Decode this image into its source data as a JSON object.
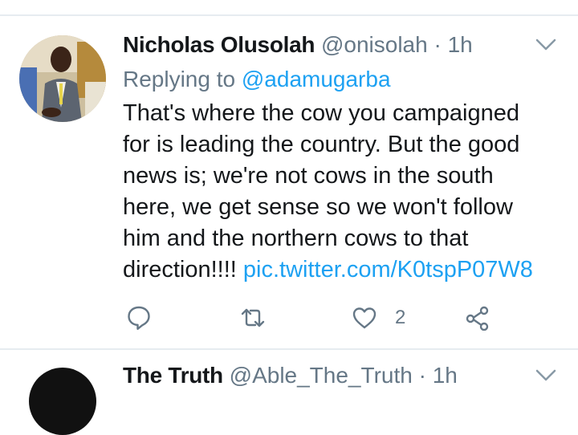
{
  "tweet": {
    "display_name": "Nicholas Olusolah",
    "handle": "@onisolah",
    "separator": "·",
    "time": "1h",
    "replying_label": "Replying to",
    "replying_to": "@adamugarba",
    "body_lines": [
      "That's where the cow you campaigned",
      "for is leading the country. But the good",
      "news is; we're not cows in the south",
      "here, we get sense so we won't follow",
      "him and the northern cows to that",
      "direction!!!!"
    ],
    "link": "pic.twitter.com/K0tspP07W8",
    "actions": {
      "reply_icon": "reply-icon",
      "retweet_icon": "retweet-icon",
      "like_icon": "heart-icon",
      "like_count": "2",
      "share_icon": "share-icon"
    },
    "menu_icon": "chevron-down-icon"
  },
  "next_tweet": {
    "display_name": "The Truth",
    "handle": "@Able_The_Truth",
    "separator": "·",
    "time": "1h"
  },
  "colors": {
    "text": "#14171a",
    "secondary": "#657786",
    "link": "#1da1f2",
    "divider": "#e6ecf0"
  }
}
